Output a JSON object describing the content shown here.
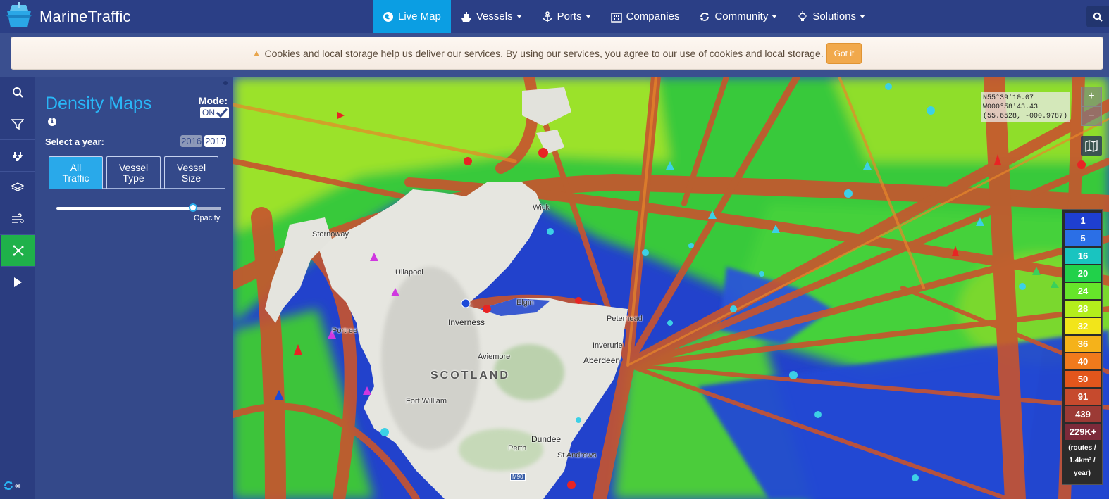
{
  "brand": {
    "name": "MarineTraffic"
  },
  "nav": {
    "items": [
      {
        "label": "Live Map",
        "icon": "globe-icon",
        "active": true,
        "dropdown": false
      },
      {
        "label": "Vessels",
        "icon": "ship-icon",
        "active": false,
        "dropdown": true
      },
      {
        "label": "Ports",
        "icon": "anchor-icon",
        "active": false,
        "dropdown": true
      },
      {
        "label": "Companies",
        "icon": "building-icon",
        "active": false,
        "dropdown": false
      },
      {
        "label": "Community",
        "icon": "refresh-icon",
        "active": false,
        "dropdown": true
      },
      {
        "label": "Solutions",
        "icon": "lightbulb-icon",
        "active": false,
        "dropdown": true
      }
    ]
  },
  "cookie": {
    "text": "Cookies and local storage help us deliver our services. By using our services, you agree to",
    "link": "our use of cookies and local storage",
    "period": ".",
    "button": "Got it"
  },
  "rail": {
    "items": [
      "search-icon",
      "filter-icon",
      "fleet-icon",
      "layers-icon",
      "wind-icon",
      "density-icon",
      "play-icon"
    ],
    "active_index": 5
  },
  "panel": {
    "title": "Density Maps",
    "mode_label": "Mode:",
    "mode_value": "ON",
    "year_label": "Select a year:",
    "years": [
      "2016",
      "2017"
    ],
    "selected_year": "2017",
    "tabs": [
      {
        "line1": "All",
        "line2": "Traffic",
        "active": true
      },
      {
        "line1": "Vessel",
        "line2": "Type",
        "active": false
      },
      {
        "line1": "Vessel",
        "line2": "Size",
        "active": false
      }
    ],
    "opacity_label": "Opacity",
    "opacity_value": 0.83
  },
  "map": {
    "coords": {
      "lat": "N55°39'10.07",
      "lon": "W000°58'43.43",
      "decimal": "(55.6528, -000.9787)"
    },
    "zoom_in": "+",
    "zoom_out": "−",
    "legend": {
      "items": [
        {
          "label": "1",
          "color": "#1e3fd0"
        },
        {
          "label": "5",
          "color": "#2b6fe6"
        },
        {
          "label": "16",
          "color": "#19c4c0"
        },
        {
          "label": "20",
          "color": "#21d14a"
        },
        {
          "label": "24",
          "color": "#66e52a"
        },
        {
          "label": "28",
          "color": "#b4ee1c"
        },
        {
          "label": "32",
          "color": "#f2e51a"
        },
        {
          "label": "36",
          "color": "#f5b21a"
        },
        {
          "label": "40",
          "color": "#f07a1c"
        },
        {
          "label": "50",
          "color": "#e2561c"
        },
        {
          "label": "91",
          "color": "#c64a2d"
        },
        {
          "label": "439",
          "color": "#9c3a35"
        },
        {
          "label": "229K+",
          "color": "#7c2a3a"
        }
      ],
      "unit1": "(routes /",
      "unit2": "1.4km² /",
      "unit3": "year)"
    },
    "places": {
      "scotland": "SCOTLAND",
      "inverness": "Inverness",
      "aberdeen": "Aberdeen",
      "dundee": "Dundee",
      "perth": "Perth",
      "peterhead": "Peterhead",
      "aviemore": "Aviemore",
      "inverurie": "Inverurie",
      "fortwilliam": "Fort William",
      "stornoway": "Stornoway",
      "ullapool": "Ullapool",
      "portree": "Portree",
      "elgin": "Elgin",
      "wick": "Wick",
      "standrews": "St Andrews",
      "m90": "M90"
    }
  }
}
